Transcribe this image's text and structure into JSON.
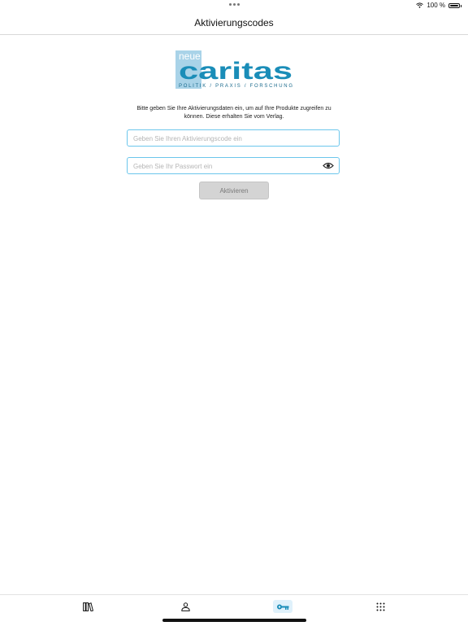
{
  "status_bar": {
    "battery_text": "100 %"
  },
  "header": {
    "title": "Aktivierungscodes"
  },
  "logo": {
    "word_top": "neue",
    "word_main": "caritas",
    "tagline": "POLITIK  /  PRAXIS  /  FORSCHUNG",
    "color": "#1a8db8",
    "box_color": "#a9d3e8"
  },
  "form": {
    "instructions": "Bitte geben Sie Ihre Aktivierungsdaten ein, um auf Ihre Produkte zugreifen zu können. Diese erhalten Sie vom Verlag.",
    "code_placeholder": "Geben Sie Ihren Aktivierungscode ein",
    "code_value": "",
    "password_placeholder": "Geben Sie Ihr Passwort ein",
    "password_value": "",
    "submit_label": "Aktivieren"
  },
  "tab_bar": {
    "items": [
      {
        "icon": "library-icon"
      },
      {
        "icon": "person-icon"
      },
      {
        "icon": "key-icon",
        "active": true
      },
      {
        "icon": "grid-icon"
      }
    ]
  },
  "colors": {
    "accent": "#6cc6ec",
    "active_tab_bg": "#dff1fb",
    "button_disabled": "#d4d4d4"
  }
}
